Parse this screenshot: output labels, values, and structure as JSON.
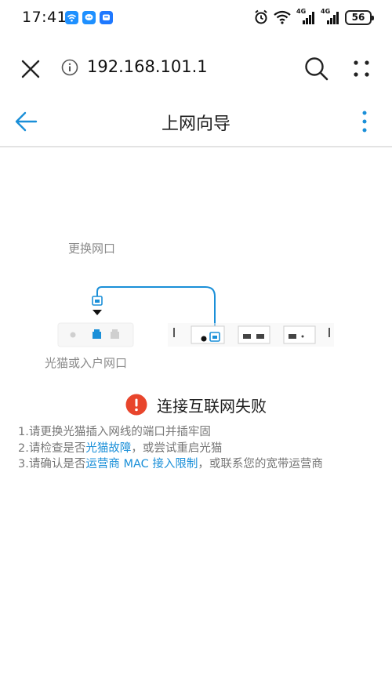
{
  "status_bar": {
    "time": "17:41",
    "apps": [
      "wifi-app-icon",
      "message-app-icon",
      "chat-app-icon"
    ],
    "sim1_network": "4G",
    "sim2_network": "4G",
    "battery": "56"
  },
  "browser": {
    "url": "192.168.101.1"
  },
  "page": {
    "title": "上网向导"
  },
  "illustration": {
    "top_label": "更换网口",
    "bottom_label": "光猫或入户网口"
  },
  "error": {
    "title": "连接互联网失败",
    "color": "#e8452c"
  },
  "steps": [
    {
      "prefix": "1.请更换光猫插入网线的端口并插牢固",
      "link": "",
      "suffix": ""
    },
    {
      "prefix": "2.请检查是否",
      "link": "光猫故障",
      "suffix": "，或尝试重启光猫"
    },
    {
      "prefix": "3.请确认是否",
      "link": "运营商 MAC 接入限制",
      "suffix": "，或联系您的宽带运营商"
    }
  ],
  "colors": {
    "accent": "#1a8fd8",
    "error": "#e8452c",
    "secondary_text": "#777777"
  }
}
